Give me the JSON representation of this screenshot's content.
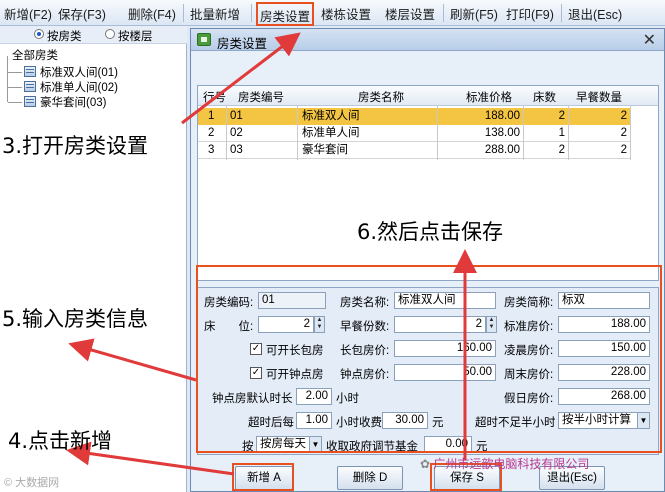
{
  "toolbar": {
    "items": [
      "新增(F2)",
      "保存(F3)",
      "删除(F4)",
      "批量新增",
      "房类设置",
      "楼栋设置",
      "楼层设置",
      "刷新(F5)",
      "打印(F9)",
      "退出(Esc)"
    ],
    "highlighted": "房类设置"
  },
  "left_panel": {
    "radios": [
      {
        "label": "按房类",
        "selected": true
      },
      {
        "label": "按楼层",
        "selected": false
      }
    ],
    "tree": {
      "root": "全部房类",
      "items": [
        "标准双人间(01)",
        "标准单人间(02)",
        "豪华套间(03)"
      ]
    }
  },
  "dialog": {
    "title": "房类设置",
    "close": "✕",
    "grid": {
      "headers": [
        "行号",
        "房类编号",
        "房类名称",
        "标准价格",
        "床数",
        "早餐数量"
      ],
      "rows": [
        {
          "no": "1",
          "code": "01",
          "name": "标准双人间",
          "price": "188.00",
          "beds": "2",
          "breakfast": "2"
        },
        {
          "no": "2",
          "code": "02",
          "name": "标准单人间",
          "price": "138.00",
          "beds": "1",
          "breakfast": "2"
        },
        {
          "no": "3",
          "code": "03",
          "name": "豪华套间",
          "price": "288.00",
          "beds": "2",
          "breakfast": "2"
        }
      ],
      "selected_row": 0
    },
    "form": {
      "code_label": "房类编码:",
      "code_value": "01",
      "name_label": "房类名称:",
      "name_value": "标准双人间",
      "short_label": "房类简称:",
      "short_value": "标双",
      "beds_label": "床　　位:",
      "beds_value": "2",
      "breakfast_label": "早餐份数:",
      "breakfast_value": "2",
      "std_price_label": "标准房价:",
      "std_price_value": "188.00",
      "long_room_label": "可开长包房",
      "long_room_checked": true,
      "long_price_label": "长包房价:",
      "long_price_value": "160.00",
      "morning_label": "凌晨房价:",
      "morning_value": "150.00",
      "hourly_room_label": "可开钟点房",
      "hourly_room_checked": true,
      "hourly_price_label": "钟点房价:",
      "hourly_price_value": "50.00",
      "weekend_label": "周末房价:",
      "weekend_value": "228.00",
      "default_hours_label": "钟点房默认时长",
      "default_hours_value": "2.00",
      "hours_unit": "小时",
      "holiday_label": "假日房价:",
      "holiday_value": "268.00",
      "overtime_label": "超时后每",
      "overtime_value": "1.00",
      "hourly_fee_label": "小时收费",
      "hourly_fee_value": "30.00",
      "yuan": "元",
      "under_half_label": "超时不足半小时",
      "under_half_value": "按半小时计算",
      "by_label": "按",
      "by_value": "按房每天",
      "gov_fund_label": "收取政府调节基金",
      "gov_fund_value": "0.00",
      "yuan2": "元"
    },
    "buttons": {
      "add": "新增 A",
      "delete": "删除 D",
      "save": "保存 S",
      "exit": "退出(Esc)"
    }
  },
  "annotations": {
    "step3": "3.打开房类设置",
    "step4": "4.点击新增",
    "step5": "5.输入房类信息",
    "step6": "6.然后点击保存"
  },
  "watermark": {
    "right": "广州市远歆电脑科技有限公司",
    "left": "大数据网"
  },
  "colors": {
    "accent_red": "#e8501f",
    "selected_row": "#f4c542",
    "annotation_arrow": "#e03a3a"
  }
}
